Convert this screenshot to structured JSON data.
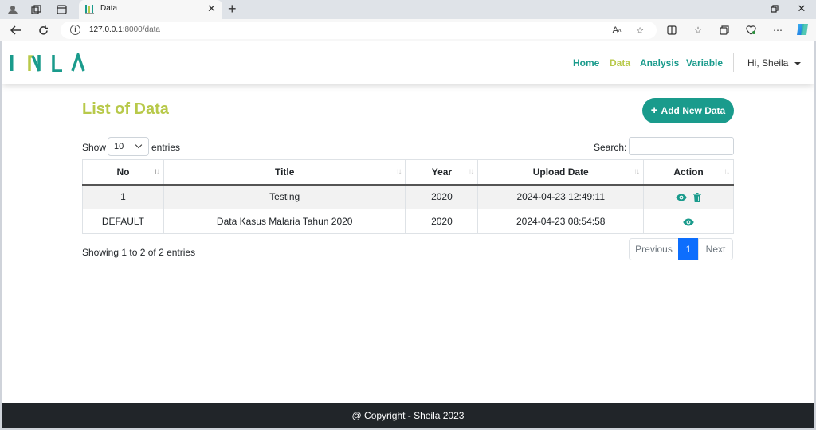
{
  "browser": {
    "tab_title": "Data",
    "url_host": "127.0.0.1",
    "url_rest": ":8000/data"
  },
  "nav": {
    "links": [
      {
        "label": "Home",
        "active": false
      },
      {
        "label": "Data",
        "active": true
      },
      {
        "label": "Analysis",
        "active": false
      },
      {
        "label": "Variable",
        "active": false
      }
    ],
    "user": "Hi, Sheila"
  },
  "page": {
    "title": "List of Data",
    "add_button": "Add New Data"
  },
  "table_controls": {
    "show_label": "Show",
    "page_length": "10",
    "entries_label": "entries",
    "search_label": "Search:",
    "search_value": ""
  },
  "table": {
    "columns": [
      "No",
      "Title",
      "Year",
      "Upload Date",
      "Action"
    ],
    "rows": [
      {
        "no": "1",
        "title": "Testing",
        "year": "2020",
        "upload_date": "2024-04-23 12:49:11",
        "actions": [
          "view",
          "delete"
        ]
      },
      {
        "no": "DEFAULT",
        "title": "Data Kasus Malaria Tahun 2020",
        "year": "2020",
        "upload_date": "2024-04-23 08:54:58",
        "actions": [
          "view"
        ]
      }
    ]
  },
  "pagination": {
    "info": "Showing 1 to 2 of 2 entries",
    "previous": "Previous",
    "current": "1",
    "next": "Next"
  },
  "footer": {
    "text": "@ Copyright - Sheila 2023"
  },
  "colors": {
    "brand_teal": "#1a9b8c",
    "brand_lime": "#b8c94a",
    "pager_active": "#0d6efd",
    "footer_bg": "#212529"
  },
  "icons": {
    "view": "eye-icon",
    "delete": "trash-icon",
    "add": "plus-icon"
  }
}
